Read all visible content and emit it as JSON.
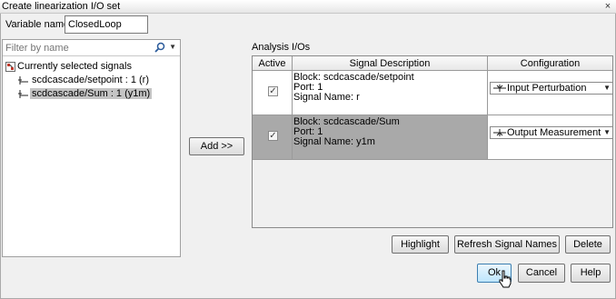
{
  "window": {
    "title": "Create linearization I/O set",
    "close_glyph": "×"
  },
  "variable": {
    "label": "Variable name:",
    "value": "ClosedLoop"
  },
  "filter": {
    "placeholder": "Filter by name",
    "search_icon": "search-icon",
    "dropdown_glyph": "▼"
  },
  "tree": {
    "root_label": "Currently selected signals",
    "items": [
      {
        "label": "scdcascade/setpoint : 1 (r)",
        "selected": false
      },
      {
        "label": "scdcascade/Sum : 1 (y1m)",
        "selected": true
      }
    ]
  },
  "add_button": "Add >>",
  "analysis": {
    "label": "Analysis I/Os",
    "columns": [
      "Active",
      "Signal Description",
      "Configuration"
    ],
    "rows": [
      {
        "active": true,
        "block": "Block: scdcascade/setpoint",
        "port": "Port: 1",
        "signal": "Signal Name: r",
        "configuration": "Input Perturbation",
        "selected": false
      },
      {
        "active": true,
        "block": "Block: scdcascade/Sum",
        "port": "Port: 1",
        "signal": "Signal Name: y1m",
        "configuration": "Output Measurement",
        "selected": true
      }
    ]
  },
  "buttons": {
    "highlight": "Highlight",
    "refresh": "Refresh Signal Names",
    "delete": "Delete",
    "ok": "Ok",
    "cancel": "Cancel",
    "help": "Help"
  },
  "check_glyph": "✓",
  "colors": {
    "selection_gray": "#a9a9a9",
    "tree_selection": "#c4c4c4",
    "ok_focus": "#3c7fb1"
  }
}
